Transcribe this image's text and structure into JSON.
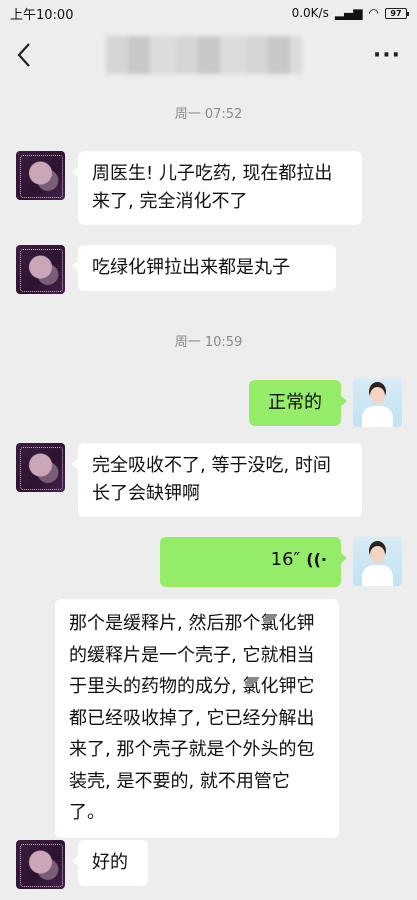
{
  "status": {
    "time": "上午10:00",
    "net_speed": "0.0K/s",
    "battery": "97"
  },
  "header": {
    "more_label": "···"
  },
  "messages": {
    "time1": "周一 07:52",
    "m1": "周医生! 儿子吃药, 现在都拉出来了, 完全消化不了",
    "m2": "吃绿化钾拉出来都是丸子",
    "time2": "周一 10:59",
    "m3": "正常的",
    "m4": "完全吸收不了, 等于没吃, 时间长了会缺钾啊",
    "m5_duration": "16″",
    "m6": "那个是缓释片, 然后那个氯化钾的缓释片是一个壳子, 它就相当于里头的药物的成分, 氯化钾它都已经吸收掉了, 它已经分解出来了, 那个壳子就是个外头的包装壳, 是不要的, 就不用管它了。",
    "m7": "好的"
  },
  "colors": {
    "background": "#ededed",
    "incoming": "#ffffff",
    "outgoing": "#95ec69",
    "timestamp": "#8a8a8a"
  },
  "icons": {
    "back": "chevron-left-icon",
    "more": "more-icon",
    "voice": "voice-wave-icon"
  }
}
